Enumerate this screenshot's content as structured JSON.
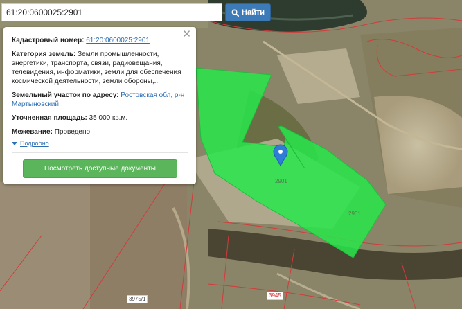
{
  "search": {
    "value": "61:20:0600025:2901",
    "button_label": "Найти",
    "button_icon": "search-icon"
  },
  "popup": {
    "cadastral_label": "Кадастровый номер:",
    "cadastral_value": "61:20:0600025:2901",
    "category_label": "Категория земель:",
    "category_value": "Земли промышленности, энергетики, транспорта, связи, радиовещания, телевидения, информатики, земли для обеспечения космической деятельности, земли обороны,...",
    "address_label": "Земельный участок по адресу:",
    "address_value": "Ростовская обл, р-н Мартыновский",
    "area_label": "Уточненная площадь:",
    "area_value": "35 000 кв.м.",
    "survey_label": "Межевание:",
    "survey_value": "Проведено",
    "more_label": "Подробно",
    "docs_button": "Посмотреть доступные документы",
    "close_icon": "close-icon"
  },
  "map": {
    "plot_labels": [
      "2901",
      "2901"
    ],
    "parcel_labels": [
      "3975/1",
      "3945"
    ],
    "marker_icon": "map-pin-icon",
    "colors": {
      "plot_fill": "#27e84a",
      "plot_stroke": "#1fbd3c",
      "marker": "#2e7dd6",
      "boundary": "#d43a3a"
    }
  }
}
